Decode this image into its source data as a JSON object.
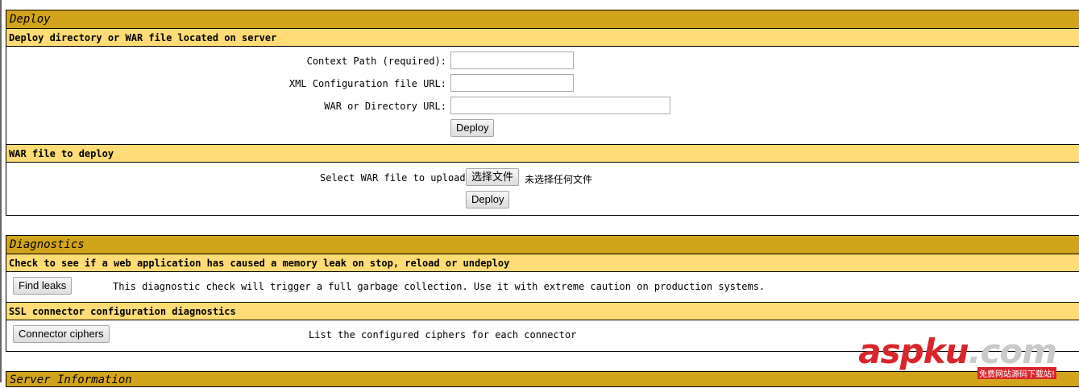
{
  "deploy": {
    "title": "Deploy",
    "server": {
      "title": "Deploy directory or WAR file located on server",
      "context_label": "Context Path (required):",
      "context_value": "",
      "xml_label": "XML Configuration file URL:",
      "xml_value": "",
      "war_label": "WAR or Directory URL:",
      "war_value": "",
      "button": "Deploy"
    },
    "upload": {
      "title": "WAR file to deploy",
      "select_label": "Select WAR file to upload",
      "choose_button": "选择文件",
      "no_file": "未选择任何文件",
      "button": "Deploy"
    }
  },
  "diagnostics": {
    "title": "Diagnostics",
    "leak": {
      "title": "Check to see if a web application has caused a memory leak on stop, reload or undeploy",
      "button": "Find leaks",
      "description": "This diagnostic check will trigger a full garbage collection. Use it with extreme caution on production systems."
    },
    "ssl": {
      "title": "SSL connector configuration diagnostics",
      "button": "Connector ciphers",
      "description": "List the configured ciphers for each connector"
    }
  },
  "server_info": {
    "title": "Server Information"
  },
  "watermark": {
    "brand_a": "asp",
    "brand_b": "ku",
    "brand_c": ".com",
    "tagline": "免费网站源码下载站!"
  }
}
